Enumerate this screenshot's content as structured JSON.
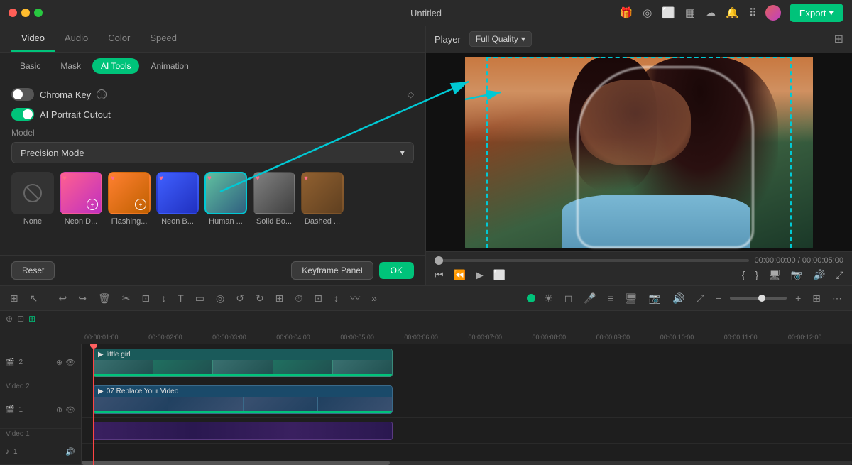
{
  "app": {
    "title": "Untitled",
    "export_label": "Export"
  },
  "tabs": {
    "main": [
      "Video",
      "Audio",
      "Color",
      "Speed"
    ],
    "main_active": "Video",
    "sub": [
      "Basic",
      "Mask",
      "AI Tools",
      "Animation"
    ],
    "sub_active": "AI Tools"
  },
  "panel": {
    "chroma_key_label": "Chroma Key",
    "ai_portrait_label": "AI Portrait Cutout",
    "model_section": "Model",
    "model_value": "Precision Mode",
    "effects": [
      {
        "name": "None",
        "label": "None",
        "selected": false
      },
      {
        "name": "Neon D...",
        "label": "Neon D...",
        "selected": false
      },
      {
        "name": "Flashing...",
        "label": "Flashing...",
        "selected": false
      },
      {
        "name": "Neon B...",
        "label": "Neon B...",
        "selected": false
      },
      {
        "name": "Human ...",
        "label": "Human ...",
        "selected": true
      },
      {
        "name": "Solid Bo...",
        "label": "Solid Bo...",
        "selected": false
      },
      {
        "name": "Dashed ...",
        "label": "Dashed ...",
        "selected": false
      }
    ],
    "reset_label": "Reset",
    "keyframe_label": "Keyframe Panel",
    "ok_label": "OK"
  },
  "player": {
    "label": "Player",
    "quality": "Full Quality",
    "time_current": "00:00:00:00",
    "time_total": "00:00:05:00"
  },
  "toolbar": {
    "icons": [
      "⊞",
      "↖",
      "↩",
      "↪",
      "🗑",
      "✂",
      "⊡",
      "↕",
      "T",
      "▭",
      "⊙",
      "↺",
      "↻",
      "⊞",
      "⏱",
      "⊡",
      "↕",
      "〰",
      "⋯",
      "»"
    ],
    "zoom_minus": "−",
    "zoom_plus": "+"
  },
  "timeline": {
    "time_marks": [
      "00:00:01:00",
      "00:00:02:00",
      "00:00:03:00",
      "00:00:04:00",
      "00:00:05:00",
      "00:00:06:00",
      "00:00:07:00",
      "00:00:08:00",
      "00:00:09:00",
      "00:00:10:00",
      "00:00:11:00",
      "00:00:12:00"
    ],
    "tracks": [
      {
        "id": "video2",
        "label": "Video 2",
        "num": "2"
      },
      {
        "id": "video1",
        "label": "Video 1",
        "num": "1"
      },
      {
        "id": "audio1",
        "label": "",
        "num": "1",
        "type": "audio"
      }
    ],
    "clips": [
      {
        "track": "video2",
        "name": "little girl",
        "color": "teal"
      },
      {
        "track": "video1",
        "name": "07 Replace Your Video",
        "color": "blue"
      }
    ]
  }
}
